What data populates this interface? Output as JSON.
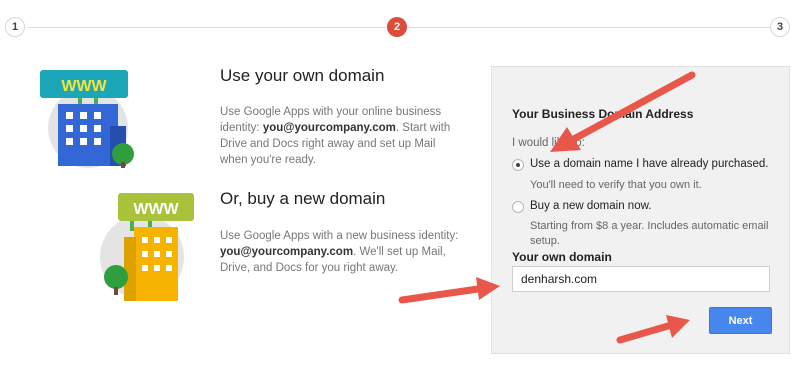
{
  "stepper": {
    "steps": [
      {
        "label": "1",
        "state": "inactive"
      },
      {
        "label": "2",
        "state": "active"
      },
      {
        "label": "3",
        "state": "inactive"
      }
    ],
    "active_color": "#dd4b39"
  },
  "options": [
    {
      "title": "Use your own domain",
      "desc_line1": "Use Google Apps with your online business identity:",
      "desc_email": "you@yourcompany.com",
      "desc_line2": ". Start with Drive and Docs right away and set up Mail when you're ready.",
      "illustration": "blue-building-www-sign",
      "sign_text": "WWW"
    },
    {
      "title": "Or, buy a new domain",
      "desc_line1": "Use Google Apps with a new business identity:",
      "desc_email": "you@yourcompany.com",
      "desc_line2": ". We'll set up Mail, Drive, and Docs for you right away.",
      "illustration": "yellow-building-www-sign",
      "sign_text": "WWW"
    }
  ],
  "form": {
    "title": "Your Business Domain Address",
    "lead": "I would like to:",
    "radios": [
      {
        "label": "Use a domain name I have already purchased.",
        "sub": "You'll need to verify that you own it.",
        "checked": true
      },
      {
        "label": "Buy a new domain now.",
        "sub": "Starting from $8 a year. Includes automatic email setup.",
        "checked": false
      }
    ],
    "field_label": "Your own domain",
    "field_value": "denharsh.com",
    "next_label": "Next",
    "button_color": "#4787ed"
  },
  "annotations": {
    "arrow_color": "#e8574a"
  }
}
